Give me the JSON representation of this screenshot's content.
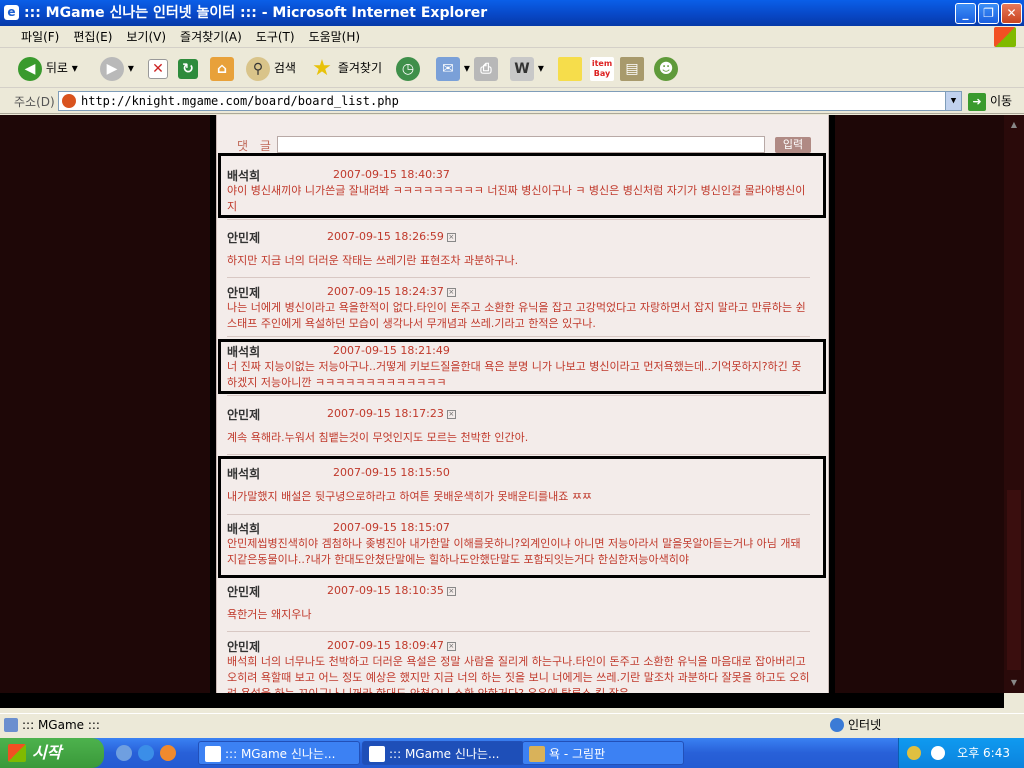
{
  "window": {
    "title": "::: MGame 신나는 인터넷 놀이터 ::: - Microsoft Internet Explorer",
    "minimize": "_",
    "maximize": "❐",
    "close": "✕"
  },
  "menu": [
    "파일(F)",
    "편집(E)",
    "보기(V)",
    "즐겨찾기(A)",
    "도구(T)",
    "도움말(H)"
  ],
  "toolbar": {
    "back": "뒤로",
    "search": "검색",
    "favorites": "즐겨찾기"
  },
  "address": {
    "label": "주소(D)",
    "url": "http://knight.mgame.com/board/board_list.php",
    "go": "이동"
  },
  "comment_form": {
    "label": "댓 글",
    "submit": "입력"
  },
  "posts": [
    {
      "author": "배석희",
      "time": "2007-09-15 18:40:37",
      "body": "야이 병신새끼야 니가쓴글 잘내려봐 ㅋㅋㅋㅋㅋㅋㅋㅋㅋ 너진짜 병신이구나 ㅋ 병신은 병신처럼 자기가 병신인걸 몰라야병신이지"
    },
    {
      "author": "안민제",
      "time": "2007-09-15 18:26:59",
      "body": "하지만 지금 너의 더러운 작태는 쓰레기란 표현조차 과분하구나."
    },
    {
      "author": "안민제",
      "time": "2007-09-15 18:24:37",
      "body": "나는 너에게 병신이라고 욕을한적이 없다.타인이 돈주고 소환한 유닉을 잡고 고강먹었다고 자랑하면서 잡지 말라고 만류하는 쉰스태프 주인에게 욕설하던 모습이 생각나서 무개념과 쓰레.기라고 한적은 있구나."
    },
    {
      "author": "배석희",
      "time": "2007-09-15 18:21:49",
      "body": "너 진짜 지능이없는 저능아구나..거떻게 키보드질을한대 욕은 분명 니가 나보고 병신이라고 먼저욕했는데..기억못하지?하긴 못하겠지 저능아니깐 ㅋㅋㅋㅋㅋㅋㅋㅋㅋㅋㅋㅋㅋ"
    },
    {
      "author": "안민제",
      "time": "2007-09-15 18:17:23",
      "body": "계속 욕해라.누워서 침뱉는것이 무엇인지도 모르는 천박한 인간아."
    },
    {
      "author": "배석희",
      "time": "2007-09-15 18:15:50",
      "body": "내가말했지 배설은 뒷구녕으로하라고 하여튼 못배운색히가 못배운티를내죠 ㅉㅉ"
    },
    {
      "author": "배석희",
      "time": "2007-09-15 18:15:07",
      "body": "안민제씹병진색히야 겜첨하나 좆병진아 내가한말 이해를못하니?외계인이냐 아니면 저능아라서 말을못알아듣는거냐 아님 개돼지같은동물이냐..?내가 한대도안쳤단말에는 힐하나도안했단말도 포함되잇는거다 한심한저능아색히야"
    },
    {
      "author": "안민제",
      "time": "2007-09-15 18:10:35",
      "body": "욕한거는 왜지우나"
    },
    {
      "author": "안민제",
      "time": "2007-09-15 18:09:47",
      "body": "배석희 너의 너무나도 천박하고 더러운 욕설은 정말 사람을 질리게 하는구나.타인이 돈주고 소환한 유닉을 마음대로 잡아버리고 오히려 욕할때 보고 어느 정도 예상은 했지만 지금 너의 하는 짓을 보니 너에게는 쓰레.기란 말조차 과분하다 잘못을 하고도 오히려 욕설을 하는 꼬이구나 니꺼라 한대도 안쳤으니 소환 안한거다? 유유에 탈루소 킬 잡은"
    }
  ],
  "status": {
    "text": "::: MGame :::",
    "zone": "인터넷"
  },
  "taskbar": {
    "start": "시작",
    "tasks": [
      "::: MGame 신나는...",
      "::: MGame 신나는...",
      "욕 - 그림판"
    ],
    "clock": "오후 6:43"
  }
}
